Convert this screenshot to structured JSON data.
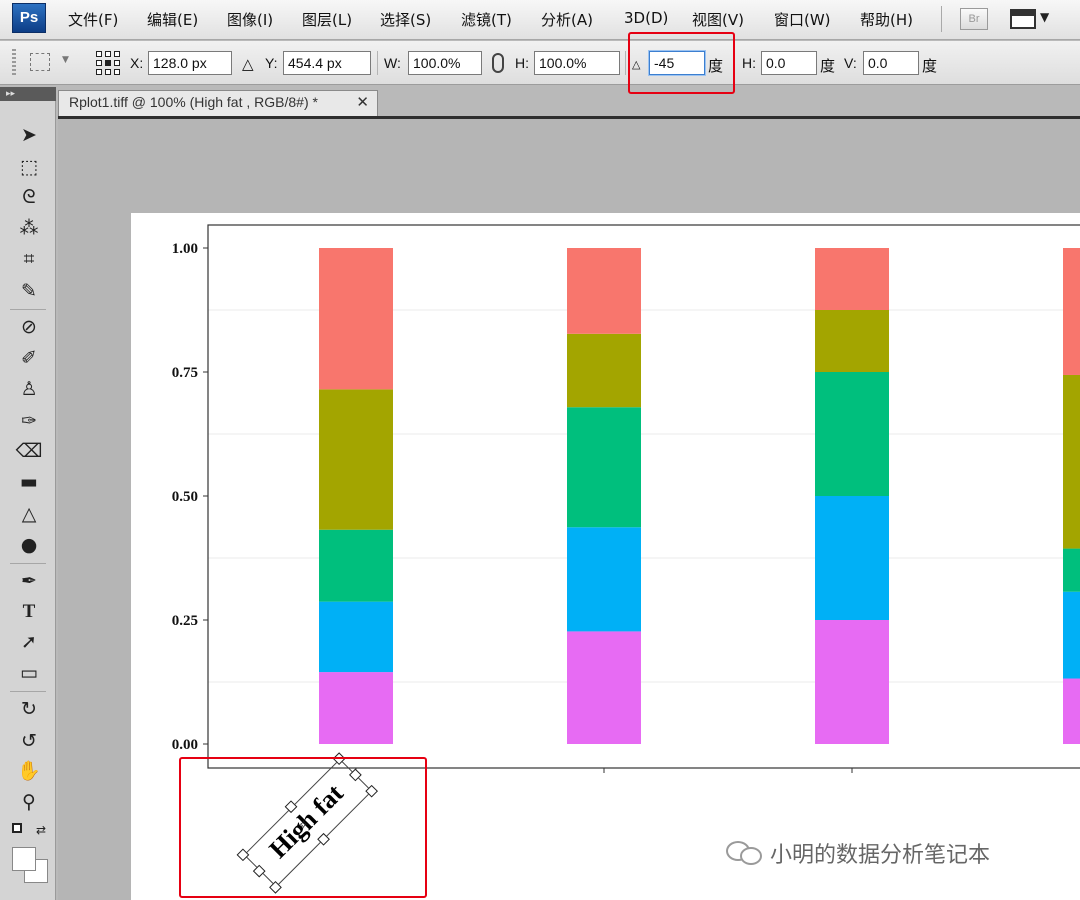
{
  "app": {
    "logo": "Ps"
  },
  "menu": [
    "文件(F)",
    "编辑(E)",
    "图像(I)",
    "图层(L)",
    "选择(S)",
    "滤镜(T)",
    "分析(A)",
    "3D(D)",
    "视图(V)",
    "窗口(W)",
    "帮助(H)"
  ],
  "bridge_label": "Br",
  "options": {
    "x_label": "X:",
    "x_value": "128.0 px",
    "y_label": "Y:",
    "y_value": "454.4 px",
    "w_label": "W:",
    "w_value": "100.0%",
    "h_label": "H:",
    "h_value": "100.0%",
    "angle_value": "-45",
    "deg_label": "度",
    "skew_h_label": "H:",
    "skew_h_value": "0.0",
    "skew_v_label": "V:",
    "skew_v_value": "0.0"
  },
  "document": {
    "tab_title": "Rplot1.tiff @ 100% (High fat , RGB/8#) *",
    "close_glyph": "✕"
  },
  "chart_data": {
    "type": "bar",
    "stacked": true,
    "ylim": [
      0,
      1
    ],
    "yticks": [
      "0.00",
      "0.25",
      "0.50",
      "0.75",
      "1.00"
    ],
    "grid": true,
    "segment_colors": [
      "#e76bf3",
      "#00b0f6",
      "#00bf7d",
      "#a3a500",
      "#f8766d"
    ],
    "stacks": [
      [
        0.145,
        0.142,
        0.145,
        0.283,
        0.285
      ],
      [
        0.227,
        0.21,
        0.242,
        0.148,
        0.173
      ],
      [
        0.25,
        0.25,
        0.25,
        0.125,
        0.125
      ],
      [
        0.132,
        0.175,
        0.087,
        0.35,
        0.256
      ]
    ]
  },
  "rotated_text": "High fat",
  "watermark": "小明的数据分析笔记本"
}
